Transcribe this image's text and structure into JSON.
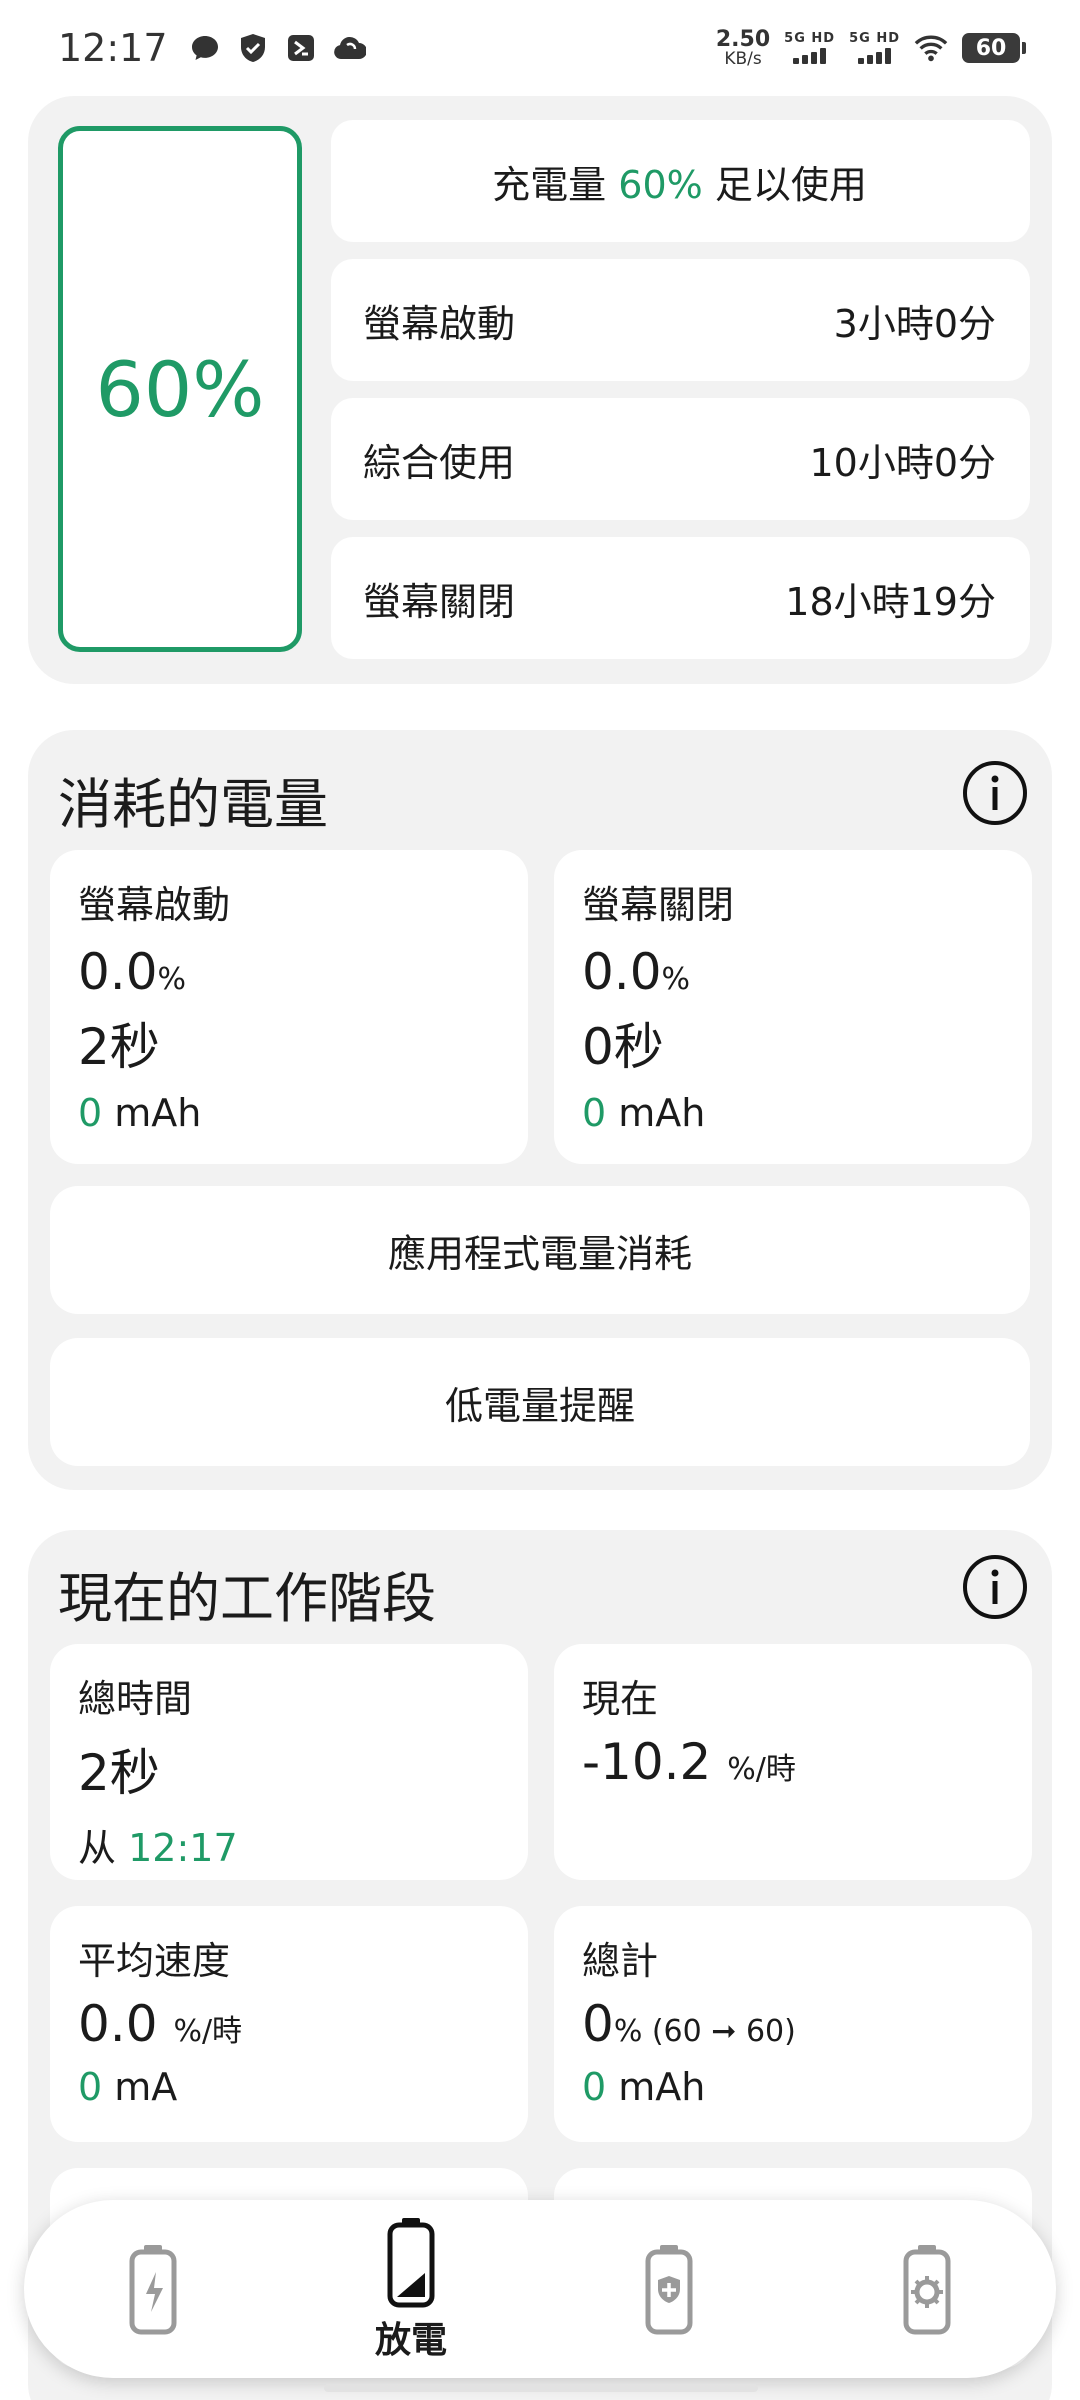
{
  "status_bar": {
    "time": "12:17",
    "net_speed_value": "2.50",
    "net_speed_unit": "KB/s",
    "sim1_label": "5G HD",
    "sim2_label": "5G HD",
    "battery_level": "60"
  },
  "summary": {
    "battery_percent": "60%",
    "charge_prefix": "充電量",
    "charge_value": "60%",
    "charge_suffix": "足以使用",
    "rows": [
      {
        "label": "螢幕啟動",
        "value": "3小時0分"
      },
      {
        "label": "綜合使用",
        "value": "10小時0分"
      },
      {
        "label": "螢幕關閉",
        "value": "18小時19分"
      }
    ]
  },
  "consumed": {
    "title": "消耗的電量",
    "screen_on": {
      "label": "螢幕啟動",
      "percent": "0.0",
      "percent_unit": "%",
      "duration": "2秒",
      "mah_value": "0",
      "mah_unit": "mAh"
    },
    "screen_off": {
      "label": "螢幕關閉",
      "percent": "0.0",
      "percent_unit": "%",
      "duration": "0秒",
      "mah_value": "0",
      "mah_unit": "mAh"
    },
    "app_usage_button": "應用程式電量消耗",
    "low_battery_button": "低電量提醒"
  },
  "session": {
    "title": "現在的工作階段",
    "total_time": {
      "label": "總時間",
      "value": "2秒",
      "from_prefix": "从",
      "from_time": "12:17"
    },
    "current": {
      "label": "現在",
      "value": "-10.2",
      "unit": "%/時"
    },
    "avg_speed": {
      "label": "平均速度",
      "value": "0.0",
      "unit": "%/時",
      "ma_value": "0",
      "ma_unit": "mA"
    },
    "total": {
      "label": "總計",
      "value": "0",
      "unit": "% (60 ➞ 60)",
      "mah_value": "0",
      "mah_unit": "mAh"
    }
  },
  "nav": {
    "active_label": "放電"
  },
  "colors": {
    "accent": "#1f9a66",
    "card_bg": "#f2f2f2"
  }
}
